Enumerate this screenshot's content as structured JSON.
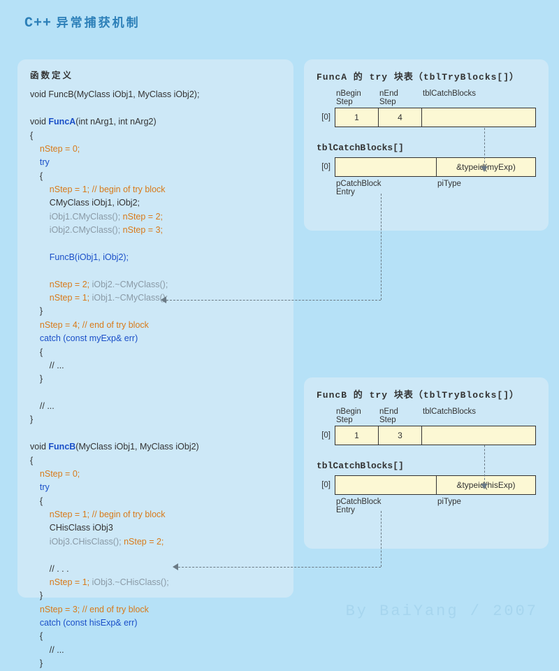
{
  "title": {
    "cpp": "C++",
    "han": "异常捕获机制"
  },
  "code": {
    "heading": "函数定义",
    "declB": "void FuncB(MyClass iObj1, MyClass iObj2);",
    "A": {
      "sig_pre": "void ",
      "sig_fn": "FuncA",
      "sig_args": "(int nArg1, int nArg2)",
      "brace_open": "{",
      "s0": "nStep = 0;",
      "try_kw": "try",
      "try_open": "{",
      "s1a": "nStep = 1; ",
      "s1b": "// begin of try block",
      "obj_decl": "CMyClass iObj1, iObj2;",
      "ctor1a": "iObj1.CMyClass(); ",
      "ctor1b": "nStep = 2;",
      "ctor2a": "iObj2.CMyClass(); ",
      "ctor2b": "nStep = 3;",
      "call": "FuncB(iObj1, iObj2);",
      "dtor2a": "nStep = 2; ",
      "dtor2b": "iObj2.~CMyClass();",
      "dtor1a": "nStep = 1; ",
      "dtor1b": "iObj1.~CMyClass();",
      "try_close": "}",
      "s4a": "nStep = 4; ",
      "s4b": "// end of try block",
      "catch_kw": "catch ",
      "catch_args": "(const myExp& err)",
      "catch_open": "{",
      "catch_body": "// ...",
      "catch_close": "}",
      "after": "// ...",
      "brace_close": "}"
    },
    "B": {
      "sig_pre": "void ",
      "sig_fn": "FuncB",
      "sig_args": "(MyClass iObj1, MyClass iObj2)",
      "brace_open": "{",
      "s0": "nStep = 0;",
      "try_kw": "try",
      "try_open": "{",
      "s1a": "nStep = 1; ",
      "s1b": "// begin of try block",
      "obj_decl": "CHisClass iObj3",
      "ctor3a": "iObj3.CHisClass(); ",
      "ctor3b": "nStep = 2;",
      "comment": "// . . .",
      "dtor3a": "nStep = 1; ",
      "dtor3b": "iObj3.~CHisClass();",
      "try_close": "}",
      "s3a": "nStep = 3; ",
      "s3b": "// end of try block",
      "catch_kw": "catch ",
      "catch_args": "(const hisExp& err)",
      "catch_open": "{",
      "catch_body": "// ...",
      "catch_close": "}"
    }
  },
  "panelA": {
    "heading": "FuncA 的 try 块表（tblTryBlocks[]）",
    "labels": {
      "c1": "nBegin\nStep",
      "c2": "nEnd\nStep",
      "c3": "tblCatchBlocks"
    },
    "idx": "[0]",
    "row": {
      "c1": "1",
      "c2": "4",
      "c3": ""
    },
    "sub_heading": "tblCatchBlocks[]",
    "idx2": "[0]",
    "row2": {
      "l": "",
      "r": "&typeid(myExp)"
    },
    "sub_labels": {
      "s1": "pCatchBlock\nEntry",
      "s2": "piType"
    }
  },
  "panelB": {
    "heading": "FuncB 的 try 块表（tblTryBlocks[]）",
    "labels": {
      "c1": "nBegin\nStep",
      "c2": "nEnd\nStep",
      "c3": "tblCatchBlocks"
    },
    "idx": "[0]",
    "row": {
      "c1": "1",
      "c2": "3",
      "c3": ""
    },
    "sub_heading": "tblCatchBlocks[]",
    "idx2": "[0]",
    "row2": {
      "l": "",
      "r": "&typeid(hisExp)"
    },
    "sub_labels": {
      "s1": "pCatchBlock\nEntry",
      "s2": "piType"
    }
  },
  "attribution": "By BaiYang / 2007"
}
